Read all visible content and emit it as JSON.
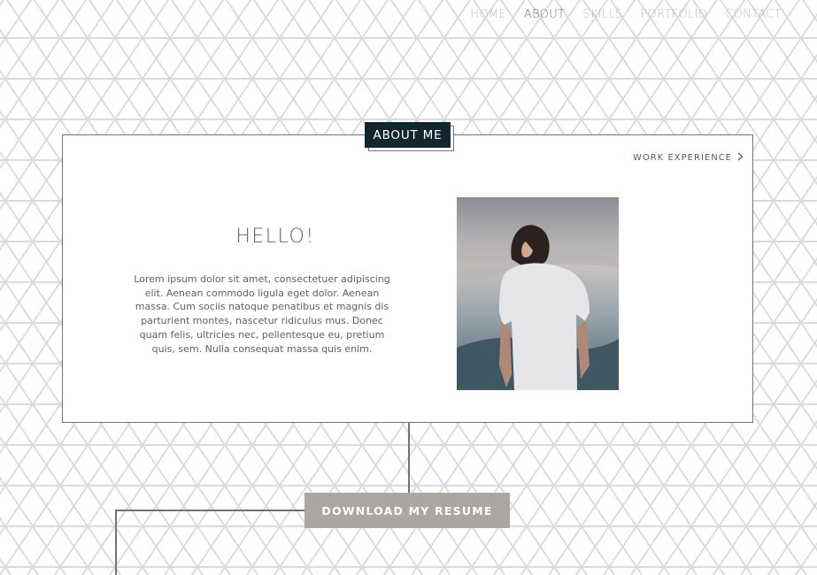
{
  "nav": {
    "items": [
      {
        "label": "HOME",
        "active": false
      },
      {
        "label": "ABOUT",
        "active": true
      },
      {
        "label": "SKILLS",
        "active": false
      },
      {
        "label": "PORTFOLIO",
        "active": false
      },
      {
        "label": "CONTACT",
        "active": false
      }
    ]
  },
  "about": {
    "section_label": "ABOUT ME",
    "work_experience_link": "WORK EXPERIENCE",
    "greeting": "HELLO!",
    "bio": "Lorem ipsum dolor sit amet, consectetuer adipiscing elit. Aenean commodo ligula eget dolor. Aenean massa. Cum sociis natoque penatibus et magnis dis parturient montes, nascetur ridiculus mus. Donec quam felis, ultricies nec, pellentesque eu, pretium quis, sem. Nulla consequat massa quis enim."
  },
  "resume": {
    "download_label": "DOWNLOAD MY RESUME"
  },
  "colors": {
    "accent_dark": "#13252f",
    "button_gray": "#aaa6a2",
    "line": "#6b7680",
    "pattern": "#d9dde1"
  },
  "icons": {
    "work_link": "chevron-right-icon"
  }
}
